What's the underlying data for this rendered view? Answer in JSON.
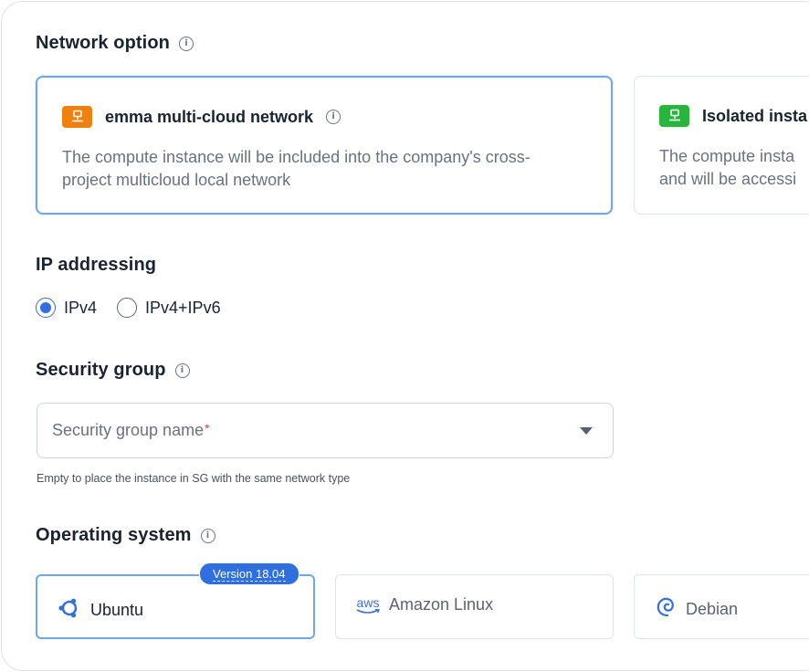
{
  "network": {
    "title": "Network option",
    "options": [
      {
        "name": "emma multi-cloud network",
        "desc_line1": "The compute instance will be included into the company's cross-",
        "desc_line2": "project multicloud local network",
        "icon": "network-icon",
        "icon_color": "#f0810f",
        "selected": true
      },
      {
        "name": "Isolated insta",
        "desc_line1": "The compute insta",
        "desc_line2": "and will be accessi",
        "icon": "network-icon",
        "icon_color": "#27b53b",
        "selected": false
      }
    ]
  },
  "ip": {
    "title": "IP addressing",
    "options": [
      {
        "label": "IPv4",
        "checked": true
      },
      {
        "label": "IPv4+IPv6",
        "checked": false
      }
    ]
  },
  "security": {
    "title": "Security group",
    "placeholder": "Security group name",
    "required_mark": "*",
    "hint": "Empty to place the instance in SG with the same network type"
  },
  "os": {
    "title": "Operating system",
    "version_tag": "Version 18.04",
    "options": [
      {
        "label": "Ubuntu",
        "icon": "ubuntu-icon",
        "selected": true
      },
      {
        "label": "Amazon Linux",
        "icon": "aws-icon",
        "icon_text": "aws",
        "selected": false
      },
      {
        "label": "Debian",
        "icon": "debian-icon",
        "selected": false
      }
    ]
  },
  "colors": {
    "accent": "#2f6fe0",
    "selected_border": "#6fa6ee"
  }
}
